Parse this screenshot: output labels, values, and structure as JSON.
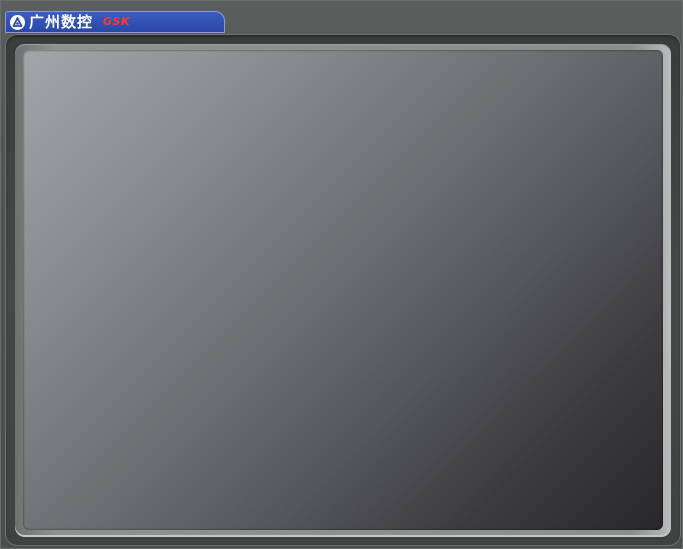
{
  "brand": {
    "name": "广州数控",
    "code": "GSK"
  },
  "colors": {
    "brand_tab": "#2f4fb2",
    "brand_code": "#ff3b2a",
    "bezel": "#4e5251",
    "screen_light": "#a4a5a9",
    "screen_dark": "#28272a"
  },
  "icons": {
    "logo": "gsk-logo-icon"
  }
}
